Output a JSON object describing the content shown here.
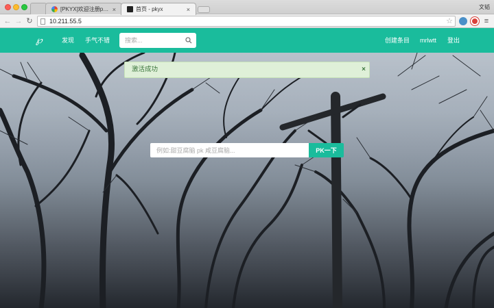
{
  "browser": {
    "user": "文韬",
    "tabs": [
      {
        "title": "[PKYX]欢迎注册pkyx,请验证",
        "close": "×",
        "favicon": "chrome-globe-icon"
      },
      {
        "title": "首页 - pkyx",
        "close": "×",
        "favicon": "pkyx-page-icon"
      }
    ],
    "url": "10.211.55.5"
  },
  "nav": {
    "links": [
      "发现",
      "手气不错"
    ],
    "search_placeholder": "搜索...",
    "right_links": [
      "创建条目",
      "mrlwtt",
      "登出"
    ]
  },
  "alert": {
    "message": "激活成功",
    "close": "×"
  },
  "pk": {
    "placeholder": "例如:甜豆腐脑 pk 咸豆腐脑...",
    "button": "PK一下"
  },
  "colors": {
    "brand": "#1abc9c",
    "alert_bg": "#dff0d8",
    "alert_text": "#3c763d"
  }
}
